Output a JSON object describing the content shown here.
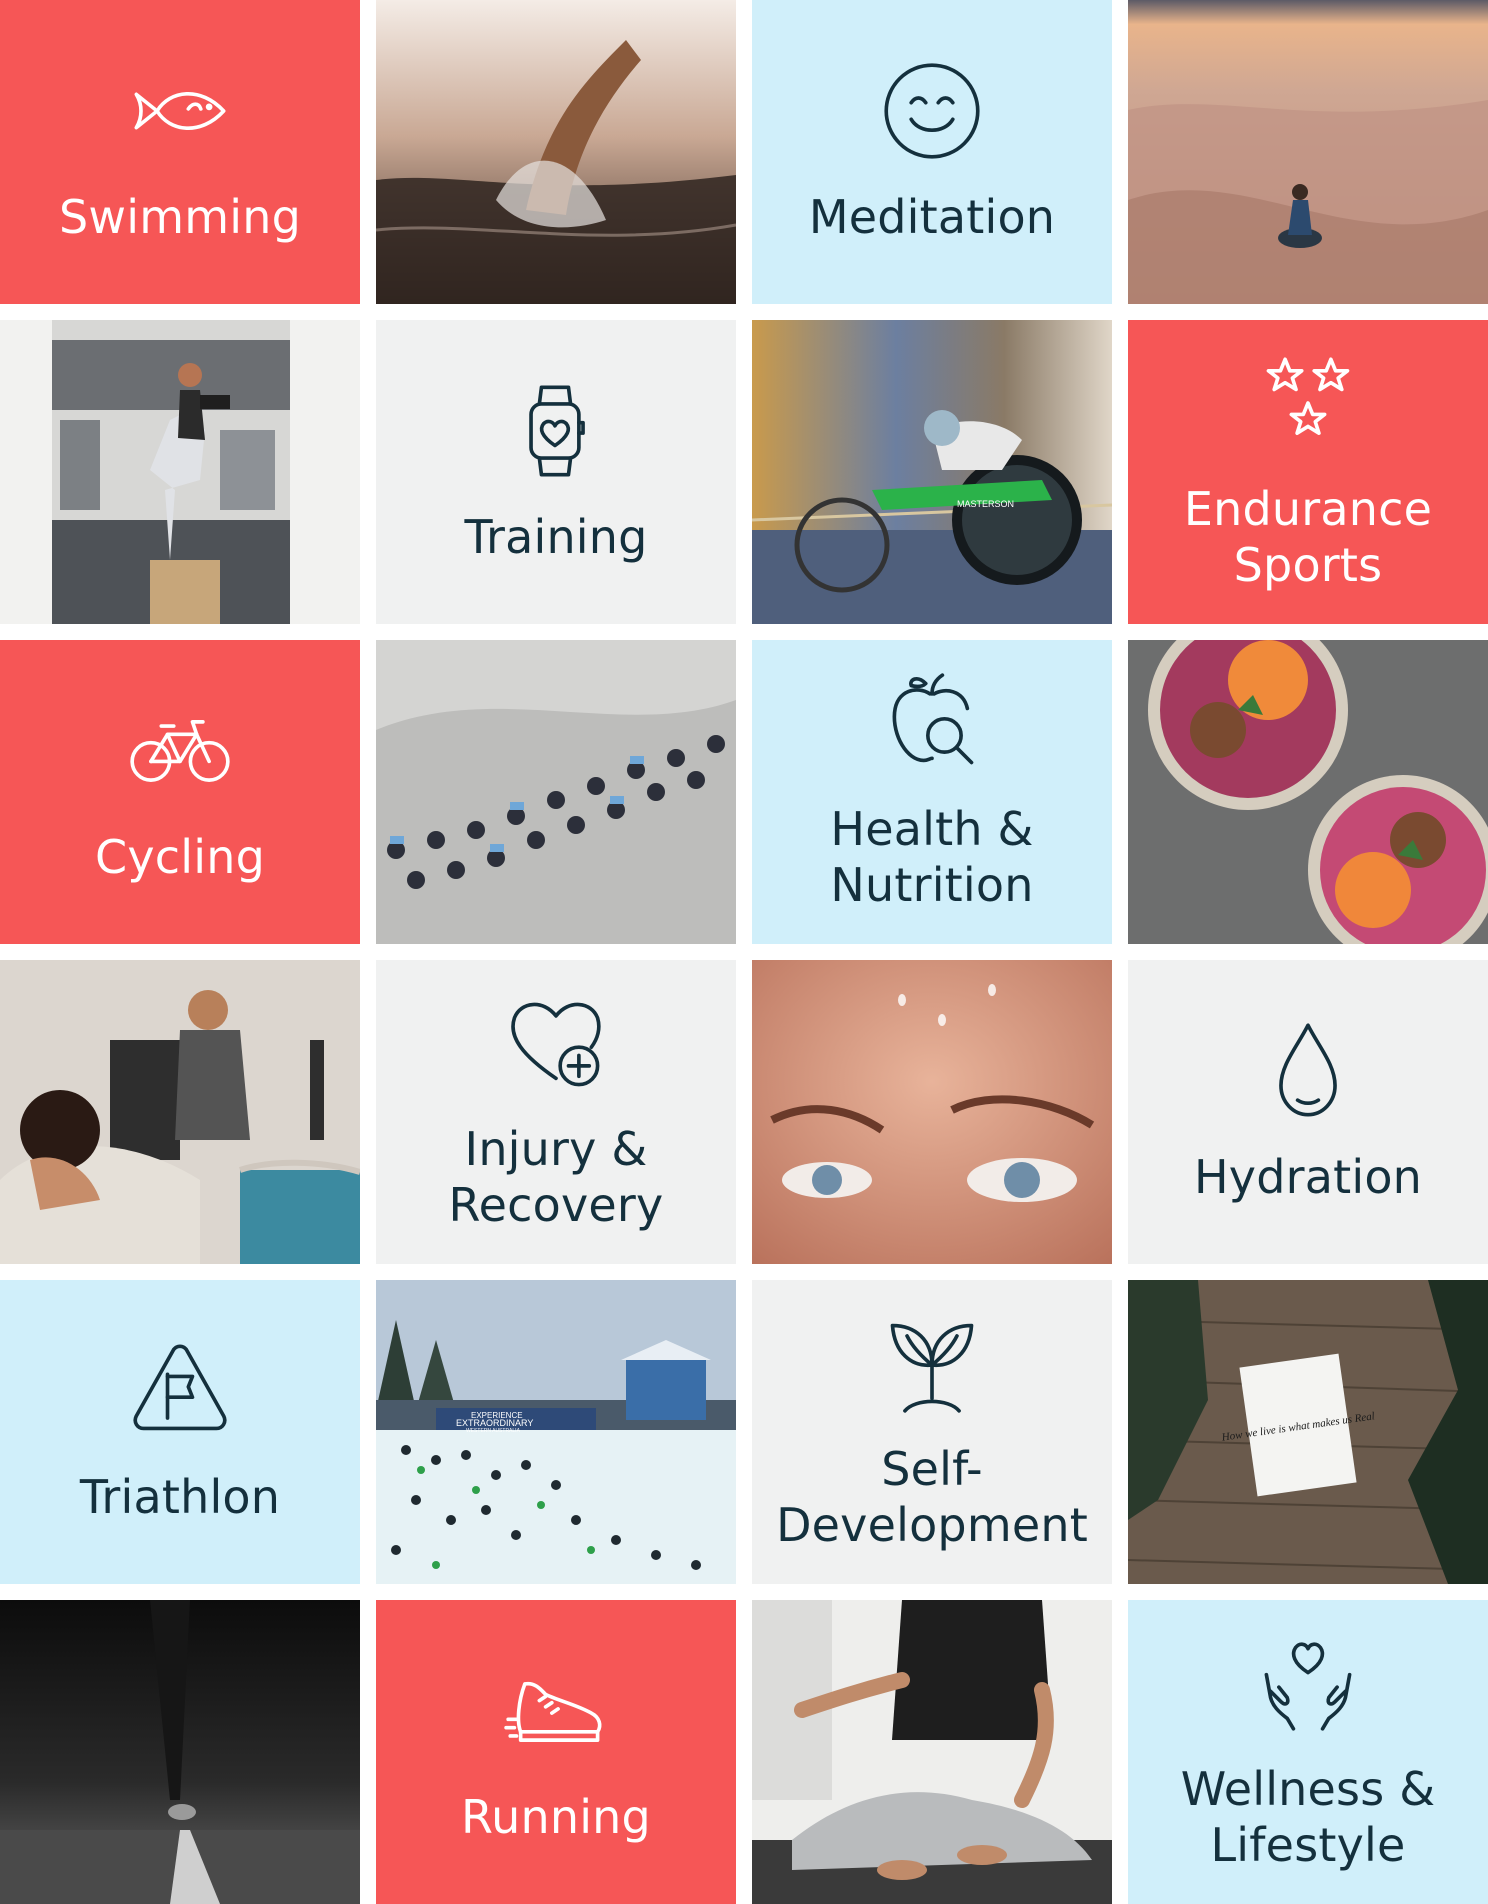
{
  "tiles": [
    {
      "label": "Swimming",
      "icon": "fish-icon"
    },
    {
      "photo": "swimmer-splash-photo"
    },
    {
      "label": "Meditation",
      "icon": "smiley-face-icon"
    },
    {
      "photo": "desert-dunes-photo"
    },
    {
      "photo": "gym-box-squat-photo"
    },
    {
      "label": "Training",
      "icon": "smartwatch-heart-icon"
    },
    {
      "photo": "wheelchair-racer-photo"
    },
    {
      "label": "Endurance\nSports",
      "icon": "three-stars-icon"
    },
    {
      "label": "Cycling",
      "icon": "bicycle-icon"
    },
    {
      "photo": "cyclists-peloton-photo"
    },
    {
      "label": "Health &\nNutrition",
      "icon": "apple-magnifier-icon"
    },
    {
      "photo": "smoothie-bowls-photo"
    },
    {
      "photo": "massage-therapy-photo"
    },
    {
      "label": "Injury &\nRecovery",
      "icon": "heart-plus-icon"
    },
    {
      "photo": "sweaty-face-closeup-photo"
    },
    {
      "label": "Hydration",
      "icon": "water-drop-icon"
    },
    {
      "label": "Triathlon",
      "icon": "triangle-flag-icon"
    },
    {
      "photo": "triathlon-swim-start-photo"
    },
    {
      "label": "Self-\nDevelopment",
      "icon": "sprout-icon"
    },
    {
      "photo": "note-card-on-wood-photo"
    },
    {
      "photo": "runner-road-photo"
    },
    {
      "label": "Running",
      "icon": "running-shoe-icon"
    },
    {
      "photo": "yoga-meditation-pose-photo"
    },
    {
      "label": "Wellness &\nLifestyle",
      "icon": "hands-heart-icon"
    }
  ],
  "photo_texts": {
    "banner_line1": "EXPERIENCE",
    "banner_line2": "EXTRAORDINARY",
    "banner_line3": "WESTERN AUSTRALIA",
    "card_text": "How we live is what makes us Real",
    "wheelchair_text": "MASTERSON"
  },
  "colors": {
    "red": "#f65656",
    "light_blue": "#d0effa",
    "light_gray": "#f0f1f1",
    "dark_navy": "#14303d",
    "white": "#ffffff"
  }
}
